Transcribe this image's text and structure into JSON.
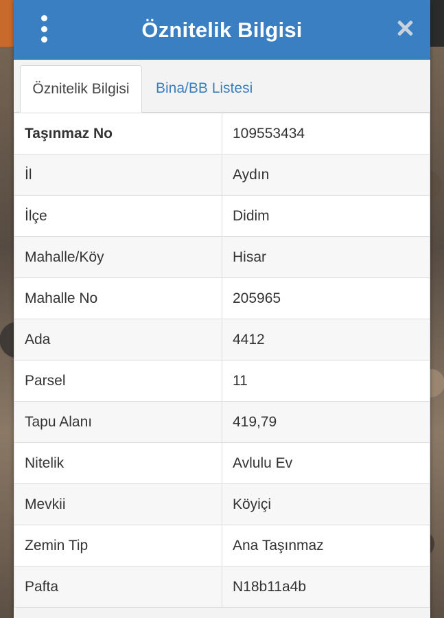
{
  "header": {
    "title": "Öznitelik Bilgisi"
  },
  "tabs": [
    {
      "label": "Öznitelik Bilgisi",
      "active": true
    },
    {
      "label": "Bina/BB Listesi",
      "active": false
    }
  ],
  "attributes": [
    {
      "key": "Taşınmaz No",
      "value": "109553434"
    },
    {
      "key": "İl",
      "value": "Aydın"
    },
    {
      "key": "İlçe",
      "value": "Didim"
    },
    {
      "key": "Mahalle/Köy",
      "value": "Hisar"
    },
    {
      "key": "Mahalle No",
      "value": "205965"
    },
    {
      "key": "Ada",
      "value": "4412"
    },
    {
      "key": "Parsel",
      "value": "11"
    },
    {
      "key": "Tapu Alanı",
      "value": "419,79"
    },
    {
      "key": "Nitelik",
      "value": "Avlulu Ev"
    },
    {
      "key": "Mevkii",
      "value": "Köyiçi"
    },
    {
      "key": "Zemin Tip",
      "value": "Ana Taşınmaz"
    },
    {
      "key": "Pafta",
      "value": "N18b11a4b"
    }
  ],
  "colors": {
    "header_bg": "#3a7fc1",
    "tab_link": "#3a7fc1"
  },
  "icons": {
    "menu": "kebab-menu-icon",
    "close": "close-icon"
  }
}
